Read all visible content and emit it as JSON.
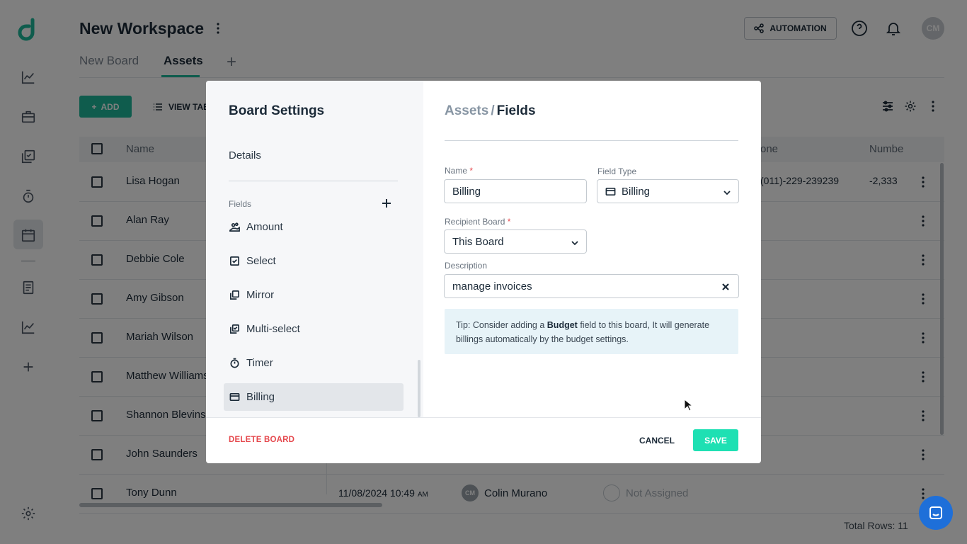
{
  "workspace": {
    "title": "New Workspace"
  },
  "tabs": [
    {
      "label": "New Board"
    },
    {
      "label": "Assets"
    }
  ],
  "header": {
    "automation_label": "AUTOMATION",
    "avatar_initials": "CM"
  },
  "toolbar": {
    "add_label": "ADD",
    "view_label": "VIEW TAB"
  },
  "grid": {
    "columns": [
      "Name",
      "one",
      "Numbe"
    ],
    "rows": [
      {
        "name": "Lisa Hogan",
        "phone": "(011)-229-239239",
        "number": "-2,333"
      },
      {
        "name": "Alan Ray"
      },
      {
        "name": "Debbie Cole"
      },
      {
        "name": "Amy Gibson"
      },
      {
        "name": "Mariah Wilson"
      },
      {
        "name": "Matthew Williams"
      },
      {
        "name": "Shannon Blevins"
      },
      {
        "name": "John Saunders"
      },
      {
        "name": "Tony Dunn",
        "date": "11/08/2024 10:49",
        "date_suffix": "AM",
        "user_initials": "CM",
        "user": "Colin Murano",
        "assignee": "Not Assigned"
      }
    ],
    "total_rows": "Total Rows: 11"
  },
  "modal": {
    "title": "Board Settings",
    "details_label": "Details",
    "fields_label": "Fields",
    "field_items": [
      {
        "label": "Amount",
        "icon": "amount-icon"
      },
      {
        "label": "Select",
        "icon": "checkbox-icon"
      },
      {
        "label": "Mirror",
        "icon": "mirror-icon"
      },
      {
        "label": "Multi-select",
        "icon": "multi-select-icon"
      },
      {
        "label": "Timer",
        "icon": "timer-icon"
      },
      {
        "label": "Billing",
        "icon": "card-icon",
        "active": true
      }
    ],
    "breadcrumb": {
      "board": "Assets",
      "separator": "/",
      "current": "Fields"
    },
    "form": {
      "name_label": "Name",
      "name_value": "Billing",
      "required_mark": "*",
      "field_type_label": "Field Type",
      "field_type_value": "Billing",
      "recipient_label": "Recipient Board",
      "recipient_value": "This Board",
      "description_label": "Description",
      "description_value": "manage invoices"
    },
    "tip": {
      "prefix": "Tip: Consider adding a ",
      "bold": "Budget",
      "suffix": " field to this board, It will generate billings automatically by the budget settings."
    },
    "footer": {
      "delete_label": "DELETE BOARD",
      "cancel_label": "CANCEL",
      "save_label": "SAVE"
    }
  },
  "colors": {
    "accent": "#1fb99a",
    "save": "#1ee0b3",
    "danger": "#e5484d",
    "chat": "#1e6fd9"
  }
}
